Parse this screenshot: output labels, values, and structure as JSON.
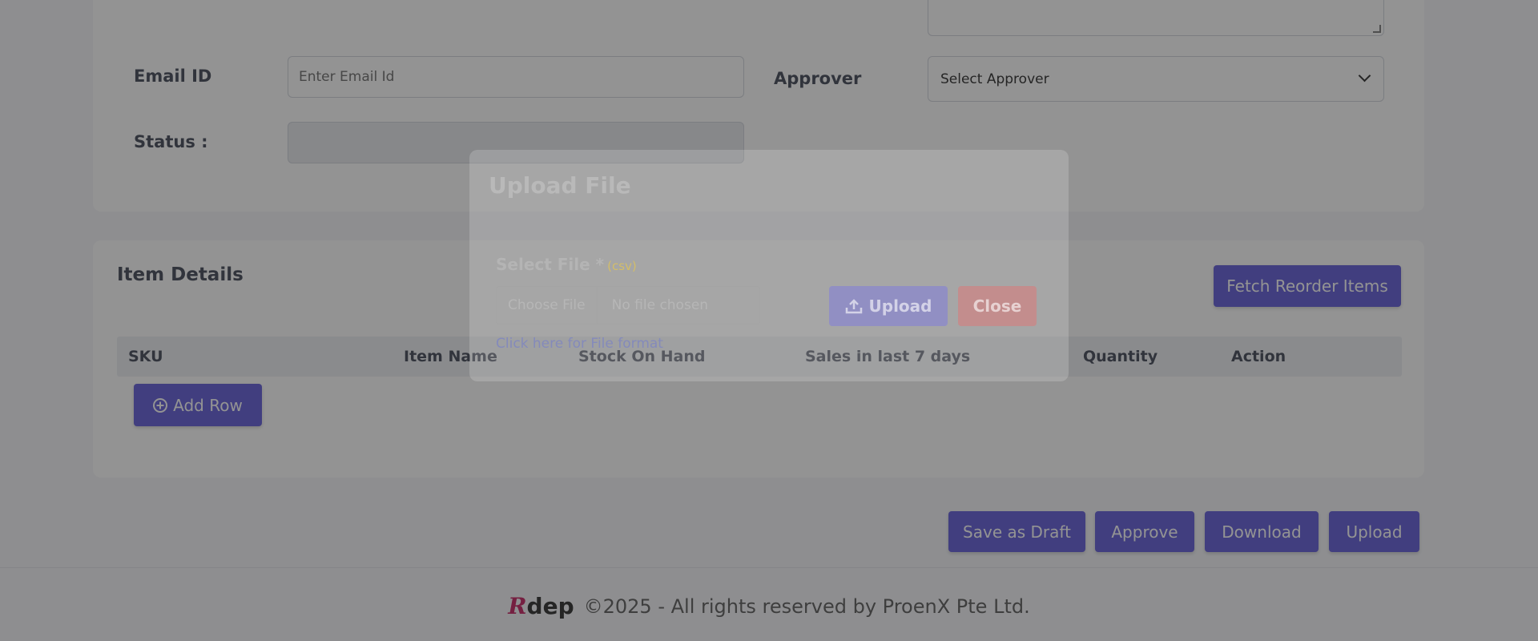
{
  "form": {
    "email_label": "Email ID",
    "email_placeholder": "Enter Email Id",
    "approver_label": "Approver",
    "approver_value": "Select Approver",
    "status_label": "Status :",
    "status_value": ""
  },
  "items": {
    "title": "Item Details",
    "fetch_button": "Fetch Reorder Items",
    "columns": [
      "SKU",
      "Item Name",
      "Stock On Hand",
      "Sales in last 7 days",
      "Quantity",
      "Action"
    ],
    "add_row_button": "Add Row"
  },
  "actions": {
    "save_draft": "Save as Draft",
    "approve": "Approve",
    "download": "Download",
    "upload": "Upload"
  },
  "footer": {
    "logo_r": "R",
    "logo_dep": "dep",
    "text": "©2025 - All rights reserved by ProenX Pte Ltd."
  },
  "modal": {
    "title": "Upload File",
    "select_label": "Select File *",
    "format_hint": "(csv)",
    "choose_file": "Choose File",
    "no_file": "No file chosen",
    "upload_button": "Upload",
    "close_button": "Close",
    "format_link": "Click here for File format"
  },
  "colors": {
    "primary": "#5a55d6",
    "danger": "#e05a5a",
    "overlay": "rgba(40,40,40,0.5)"
  },
  "icons": {
    "add_row": "plus-circle-icon",
    "upload": "upload-icon",
    "select": "chevron-down-icon"
  }
}
